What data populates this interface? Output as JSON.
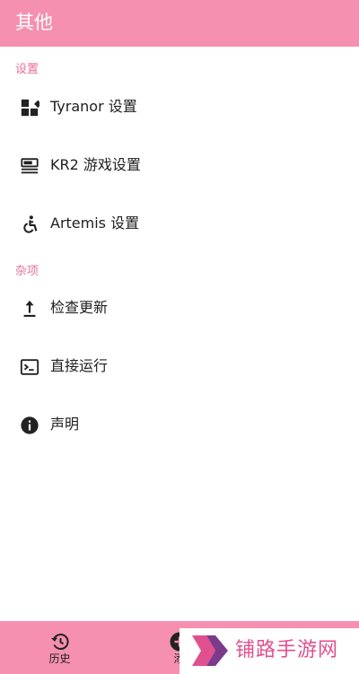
{
  "header": {
    "title": "其他"
  },
  "sections": [
    {
      "title": "设置",
      "items": [
        {
          "label": "Tyranor 设置",
          "icon": "dashboard-icon"
        },
        {
          "label": "KR2 游戏设置",
          "icon": "video-settings-icon"
        },
        {
          "label": "Artemis 设置",
          "icon": "accessible-icon"
        }
      ]
    },
    {
      "title": "杂项",
      "items": [
        {
          "label": "检查更新",
          "icon": "upload-icon"
        },
        {
          "label": "直接运行",
          "icon": "terminal-icon"
        },
        {
          "label": "声明",
          "icon": "info-icon"
        }
      ]
    }
  ],
  "bottom_nav": {
    "items": [
      {
        "label": "历史",
        "icon": "history-icon"
      },
      {
        "label": "添",
        "icon": "add-circle-icon"
      }
    ]
  },
  "watermark": {
    "text": "铺路手游网"
  },
  "colors": {
    "accent": "#f590b0",
    "section_header": "#e96f97",
    "watermark_text": "#e0508f"
  }
}
